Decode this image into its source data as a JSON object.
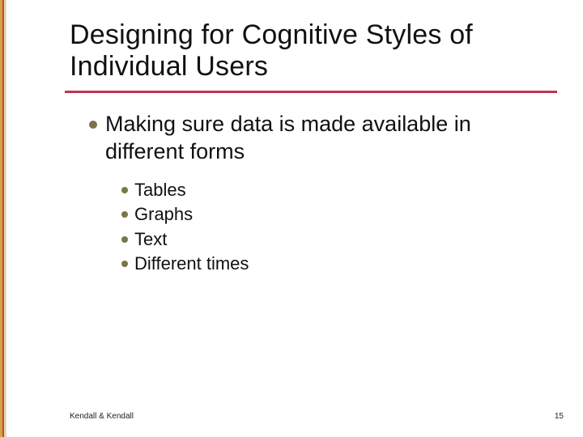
{
  "slide": {
    "title": "Designing for Cognitive Styles of Individual Users",
    "bullets": [
      {
        "text": "Making sure data is made available in different forms",
        "children": [
          {
            "text": "Tables"
          },
          {
            "text": "Graphs"
          },
          {
            "text": "Text"
          },
          {
            "text": "Different times"
          }
        ]
      }
    ],
    "footer": "Kendall & Kendall",
    "page_number": "15"
  },
  "colors": {
    "rule": "#c6304a",
    "bullet": "#7a7548"
  }
}
